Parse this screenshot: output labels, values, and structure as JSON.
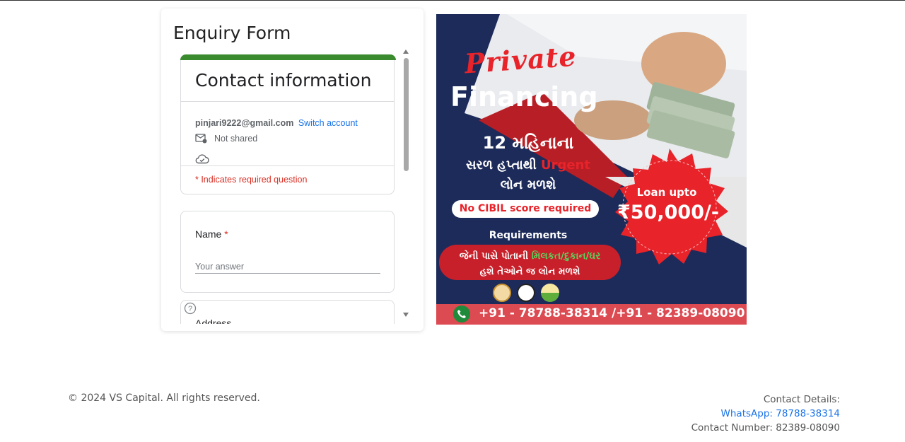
{
  "enquiry": {
    "title": "Enquiry Form",
    "form": {
      "contact_title": "Contact information",
      "email": "pinjari9222@gmail.com",
      "switch_account": "Switch account",
      "not_shared": "Not shared",
      "required_note": "* Indicates required question",
      "name_label": "Name",
      "required_star": "*",
      "name_placeholder": "Your answer",
      "address_label": "Address"
    }
  },
  "ad": {
    "private": "Private",
    "financing": "Financing",
    "line1": "12 મહિનાના",
    "line2_a": "સરળ હપ્તાથી ",
    "line2_urgent": "Urgent",
    "line3": "લોન મળશે",
    "cibil": "No CIBIL score required",
    "loan_upto": "Loan upto",
    "amount": "₹50,000/-",
    "requirements": "Requirements",
    "req_line1_a": "જેની પાસે પોતાની ",
    "req_line1_green": "મિલકત/દુકાન/ઘર",
    "req_line2": "હશે તેઓને જ લોન મળશે",
    "phones": "+91 - 78788-38314  /+91 - 82389-08090",
    "colors": {
      "navy": "#1d2b5a",
      "red": "#e8232a",
      "phone_bar": "#dc4a52"
    }
  },
  "footer": {
    "copyright": "© 2024 VS Capital. All rights reserved.",
    "contact_heading": "Contact Details:",
    "whatsapp": "WhatsApp: 78788-38314",
    "contact_number": "Contact Number: 82389-08090"
  }
}
